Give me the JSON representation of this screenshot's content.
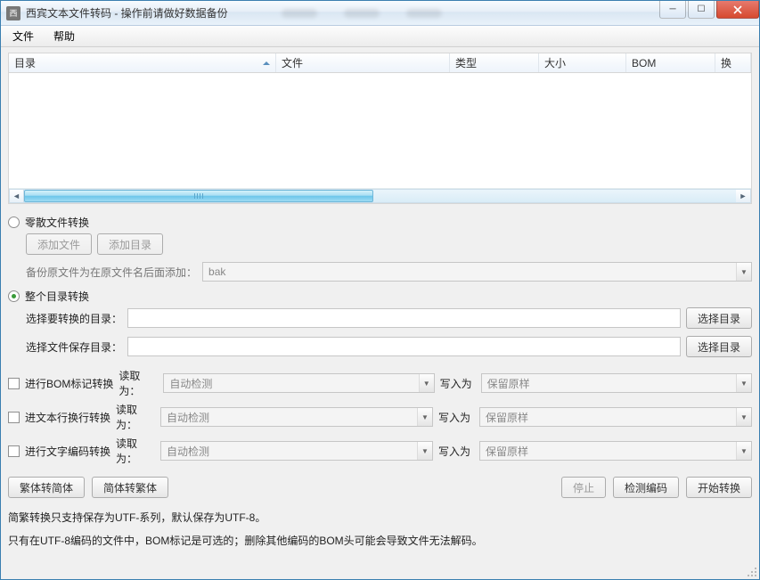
{
  "window": {
    "title": "西宾文本文件转码 - 操作前请做好数据备份"
  },
  "menubar": {
    "file": "文件",
    "help": "帮助"
  },
  "table": {
    "columns": {
      "dir": "目录",
      "file": "文件",
      "type": "类型",
      "size": "大小",
      "bom": "BOM",
      "br": "换"
    }
  },
  "mode": {
    "scatter": "零散文件转换",
    "whole": "整个目录转换",
    "selected": "whole"
  },
  "scatter": {
    "add_file": "添加文件",
    "add_dir": "添加目录",
    "backup_label": "备份原文件为在原文件名后面添加：",
    "backup_value": "bak"
  },
  "whole": {
    "source_label": "选择要转换的目录：",
    "dest_label": "选择文件保存目录：",
    "browse": "选择目录",
    "source_value": "",
    "dest_value": ""
  },
  "options": {
    "bom": {
      "check": "进行BOM标记转换",
      "read_label": "读取为：",
      "read": "自动检测",
      "write_label": "写入为",
      "write": "保留原样"
    },
    "newline": {
      "check": "进文本行换行转换",
      "read_label": "读取为：",
      "read": "自动检测",
      "write_label": "写入为",
      "write": "保留原样"
    },
    "encoding": {
      "check": "进行文字编码转换",
      "read_label": "读取为：",
      "read": "自动检测",
      "write_label": "写入为",
      "write": "保留原样"
    }
  },
  "buttons": {
    "trad2simp": "繁体转简体",
    "simp2trad": "简体转繁体",
    "stop": "停止",
    "detect": "检测编码",
    "start": "开始转换"
  },
  "hints": {
    "line1": "简繁转换只支持保存为UTF-系列，默认保存为UTF-8。",
    "line2": "只有在UTF-8编码的文件中，BOM标记是可选的；删除其他编码的BOM头可能会导致文件无法解码。"
  }
}
